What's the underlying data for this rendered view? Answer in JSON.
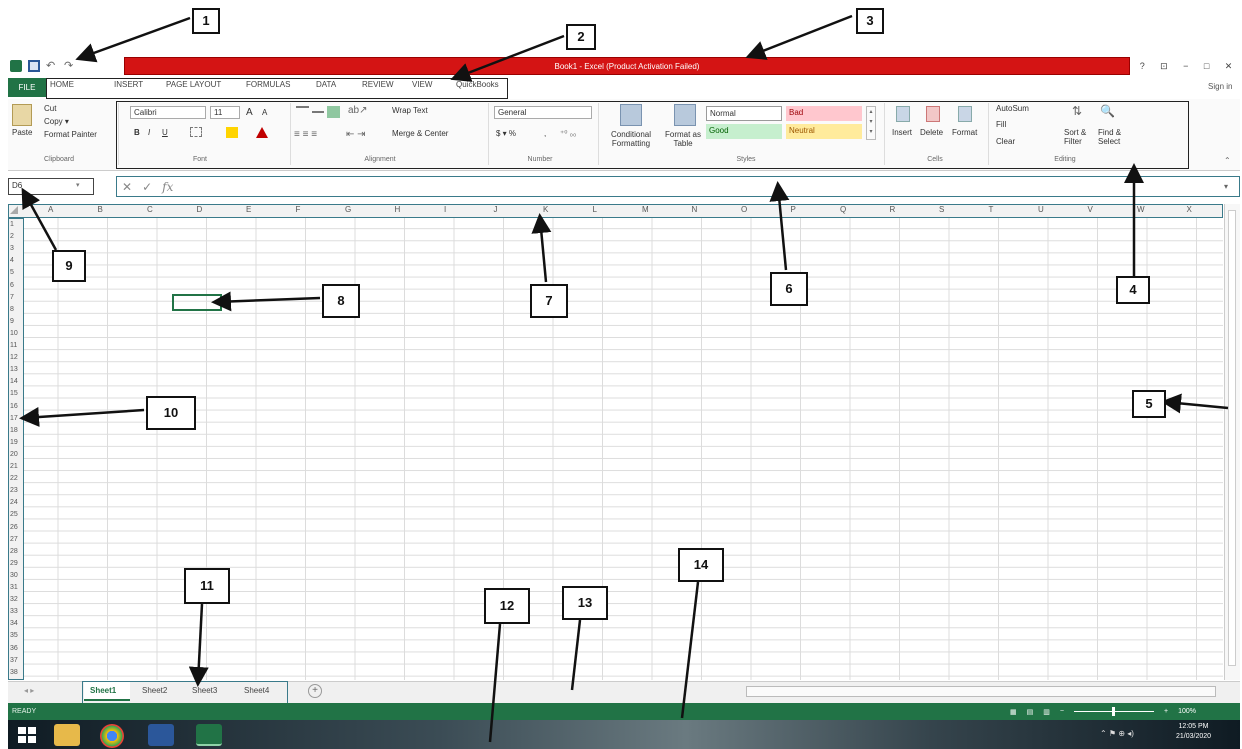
{
  "window": {
    "title": "Book1 - Excel (Product Activation Failed)",
    "controls": [
      "?",
      "⊡",
      "−",
      "□",
      "✕"
    ],
    "sign_in": "Sign in"
  },
  "tabs": {
    "file": "FILE",
    "items": [
      "HOME",
      "INSERT",
      "PAGE LAYOUT",
      "FORMULAS",
      "DATA",
      "REVIEW",
      "VIEW",
      "QuickBooks"
    ]
  },
  "ribbon": {
    "clipboard": {
      "paste": "Paste",
      "cut": "Cut",
      "copy": "Copy ▾",
      "format_painter": "Format Painter",
      "label": "Clipboard"
    },
    "font": {
      "name": "Calibri",
      "size": "11",
      "grow": "A",
      "shrink": "A",
      "bold": "B",
      "italic": "I",
      "underline": "U",
      "label": "Font"
    },
    "alignment": {
      "wrap": "Wrap Text",
      "merge": "Merge & Center",
      "label": "Alignment"
    },
    "number": {
      "format": "General",
      "currency": "$ ▾ %",
      "comma": ",",
      "label": "Number"
    },
    "styles": {
      "conditional": "Conditional Formatting",
      "format_table": "Format as Table",
      "normal": "Normal",
      "bad": "Bad",
      "good": "Good",
      "neutral": "Neutral",
      "label": "Styles",
      "colors": {
        "normal": "#ffffff",
        "bad": "#ffc7ce",
        "good": "#c6efce",
        "neutral": "#ffeb9c"
      }
    },
    "cells": {
      "insert": "Insert",
      "delete": "Delete",
      "format": "Format",
      "label": "Cells"
    },
    "editing": {
      "autosum": "AutoSum",
      "fill": "Fill",
      "clear": "Clear",
      "sort": "Sort & Filter",
      "find": "Find & Select",
      "label": "Editing"
    }
  },
  "formula_bar": {
    "name_box": "D6",
    "cancel": "✕",
    "enter": "✓",
    "fx": "fx",
    "value": ""
  },
  "columns": [
    "A",
    "B",
    "C",
    "D",
    "E",
    "F",
    "G",
    "H",
    "I",
    "J",
    "K",
    "L",
    "M",
    "N",
    "O",
    "P",
    "Q",
    "R",
    "S",
    "T",
    "U",
    "V",
    "W",
    "X"
  ],
  "rows": [
    "1",
    "2",
    "3",
    "4",
    "5",
    "6",
    "7",
    "8",
    "9",
    "10",
    "11",
    "12",
    "13",
    "14",
    "15",
    "16",
    "17",
    "18",
    "19",
    "20",
    "21",
    "22",
    "23",
    "24",
    "25",
    "26",
    "27",
    "28",
    "29",
    "30",
    "31",
    "32",
    "33",
    "34",
    "35",
    "36",
    "37",
    "38"
  ],
  "sheets": [
    "Sheet1",
    "Sheet2",
    "Sheet3",
    "Sheet4"
  ],
  "status": {
    "ready": "READY",
    "zoom": "100%"
  },
  "taskbar": {
    "time": "12:05 PM",
    "date": "21/03/2020"
  },
  "callouts": [
    "1",
    "2",
    "3",
    "4",
    "5",
    "6",
    "7",
    "8",
    "9",
    "10",
    "11",
    "12",
    "13",
    "14"
  ],
  "colors": {
    "excel_green": "#217346",
    "title_red": "#d41414"
  }
}
